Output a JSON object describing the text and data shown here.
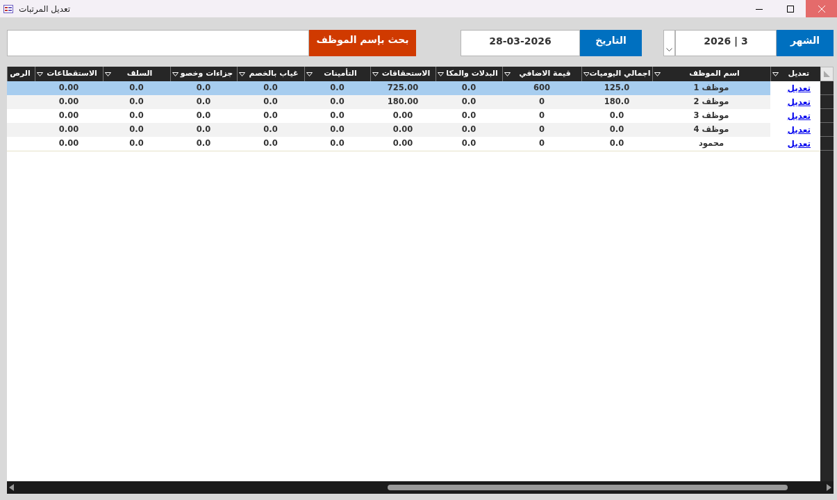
{
  "window": {
    "title": "تعديل المرتبات"
  },
  "month": {
    "label": "الشهر",
    "value": "3 | 2026"
  },
  "date": {
    "label": "التاريخ",
    "value": "28-03-2026"
  },
  "search": {
    "label": "بحث بإسم الموظف"
  },
  "table": {
    "columns": [
      {
        "label": "تعديل",
        "filter": true
      },
      {
        "label": "اسم الموظف",
        "filter": true
      },
      {
        "label": "اجمالي اليوميات",
        "filter": true
      },
      {
        "label": "قيمة الاضافي",
        "filter": true
      },
      {
        "label": "البدلات والمكا",
        "filter": true
      },
      {
        "label": "الاستحقاقات",
        "filter": true
      },
      {
        "label": "التأمينات",
        "filter": true
      },
      {
        "label": "غياب بالخصم",
        "filter": true
      },
      {
        "label": "جزاءات وخصو",
        "filter": true
      },
      {
        "label": "السلف",
        "filter": true
      },
      {
        "label": "الاستقطاعات",
        "filter": true
      },
      {
        "label": "الرص",
        "filter": false
      }
    ],
    "rows": [
      {
        "selected": true,
        "cells": [
          "تعديل",
          "موظف 1",
          "125.0",
          "600",
          "0.0",
          "725.00",
          "0.0",
          "0.0",
          "0.0",
          "0.0",
          "0.00"
        ]
      },
      {
        "selected": false,
        "cells": [
          "تعديل",
          "موظف 2",
          "180.0",
          "0",
          "0.0",
          "180.00",
          "0.0",
          "0.0",
          "0.0",
          "0.0",
          "0.00"
        ]
      },
      {
        "selected": false,
        "cells": [
          "تعديل",
          "موظف 3",
          "0.0",
          "0",
          "0.0",
          "0.00",
          "0.0",
          "0.0",
          "0.0",
          "0.0",
          "0.00"
        ]
      },
      {
        "selected": false,
        "cells": [
          "تعديل",
          "موظف 4",
          "0.0",
          "0",
          "0.0",
          "0.00",
          "0.0",
          "0.0",
          "0.0",
          "0.0",
          "0.00"
        ]
      },
      {
        "selected": false,
        "cells": [
          "تعديل",
          "محمود",
          "0.0",
          "0",
          "0.0",
          "0.00",
          "0.0",
          "0.0",
          "0.0",
          "0.0",
          "0.00"
        ]
      }
    ]
  }
}
